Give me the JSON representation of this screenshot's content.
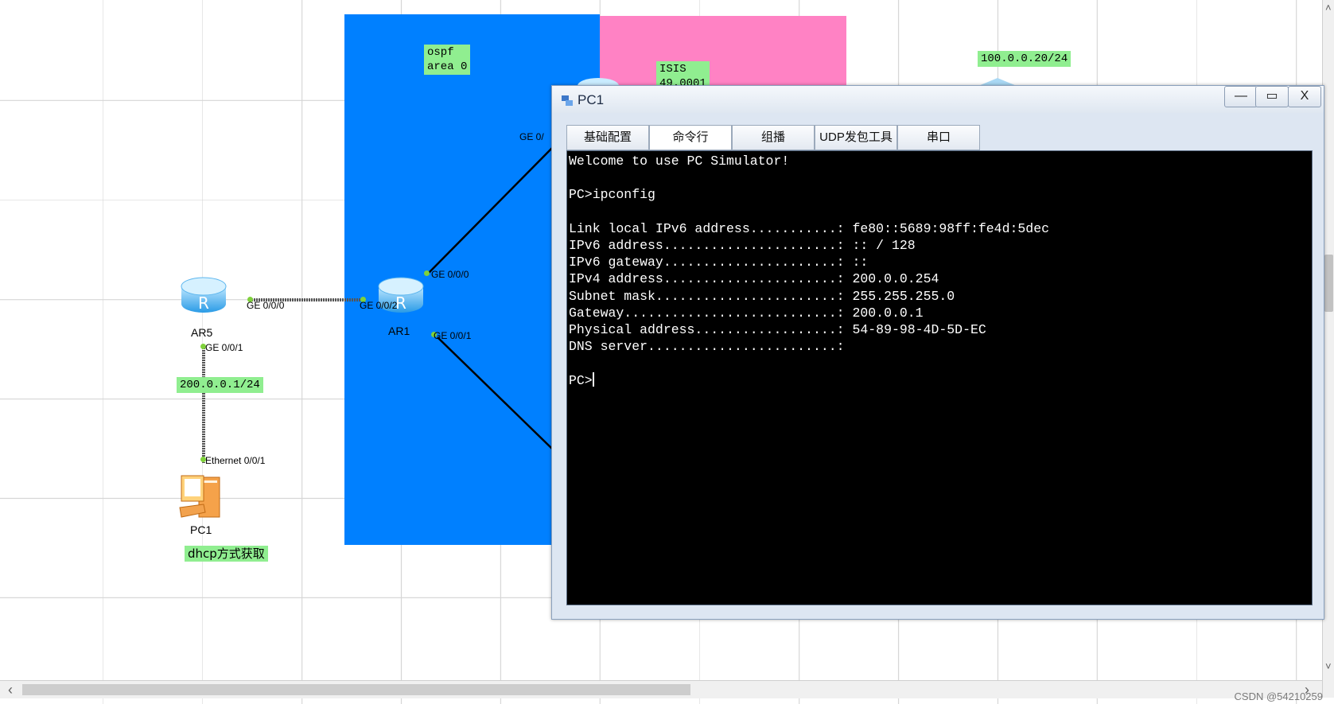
{
  "topology": {
    "areas": [
      {
        "name": "ospf-area",
        "color": "#0080ff"
      },
      {
        "name": "isis-area",
        "color": "#ff82c4"
      }
    ],
    "notes": {
      "ospf": "ospf\narea 0",
      "isis": "ISIS\n49.0001",
      "subnet_right": "100.0.0.20/24",
      "subnet_left": "200.0.0.1/24",
      "dhcp": "dhcp方式获取"
    },
    "devices": {
      "ar5": {
        "name": "AR5",
        "icon": "router-icon"
      },
      "ar1": {
        "name": "AR1",
        "icon": "router-icon"
      },
      "pc1": {
        "name": "PC1",
        "icon": "pc-icon"
      }
    },
    "ports": {
      "ar5_ge000": "GE 0/0/0",
      "ar5_ge001": "GE 0/0/1",
      "ar1_ge002": "GE 0/0/2",
      "ar1_ge000": "GE 0/0/0",
      "ar1_ge001": "GE 0/0/1",
      "top_ge0": "GE 0/",
      "pc_eth": "Ethernet 0/0/1"
    }
  },
  "window": {
    "title": "PC1",
    "controls": {
      "minimize": "—",
      "maximize": "▭",
      "close": "X"
    },
    "tabs": [
      "基础配置",
      "命令行",
      "组播",
      "UDP发包工具",
      "串口"
    ],
    "active_tab": "命令行",
    "terminal": {
      "lines": [
        "Welcome to use PC Simulator!",
        "",
        "PC>ipconfig",
        "",
        "Link local IPv6 address...........: fe80::5689:98ff:fe4d:5dec",
        "IPv6 address......................: :: / 128",
        "IPv6 gateway......................: ::",
        "IPv4 address......................: 200.0.0.254",
        "Subnet mask.......................: 255.255.255.0",
        "Gateway...........................: 200.0.0.1",
        "Physical address..................: 54-89-98-4D-5D-EC",
        "DNS server........................:",
        ""
      ],
      "prompt": "PC>"
    }
  },
  "scrollbar": {
    "left_arrow": "‹",
    "right_arrow": "›",
    "up_arrow": "˄",
    "down_arrow": "˅"
  },
  "watermark": "CSDN @54210259"
}
